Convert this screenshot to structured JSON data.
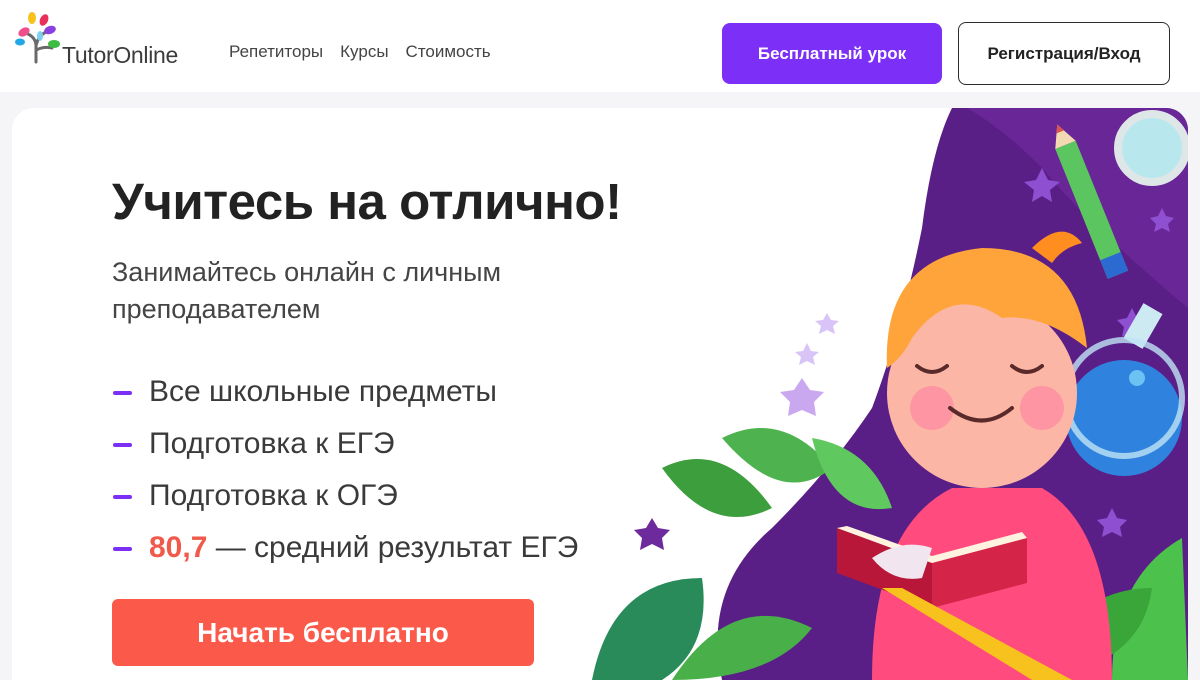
{
  "colors": {
    "accent": "#7b2ff7",
    "cta": "#fb5a4b",
    "highlight": "#f05a4a"
  },
  "header": {
    "logo_text": "TutorOnline",
    "logo_icon": "tree-logo-icon",
    "nav": [
      "Репетиторы",
      "Курсы",
      "Стоимость"
    ],
    "free_lesson_label": "Бесплатный урок",
    "login_label": "Регистрация/Вход"
  },
  "hero": {
    "title": "Учитесь на отлично!",
    "subtitle": "Занимайтесь онлайн с личным преподавателем",
    "features": [
      "Все школьные предметы",
      "Подготовка к ЕГЭ",
      "Подготовка к ОГЭ"
    ],
    "score_value": "80,7",
    "score_text": " — средний результат ЕГЭ",
    "cta_label": "Начать бесплатно",
    "illustration_icon": "boy-reading-book-illustration"
  }
}
